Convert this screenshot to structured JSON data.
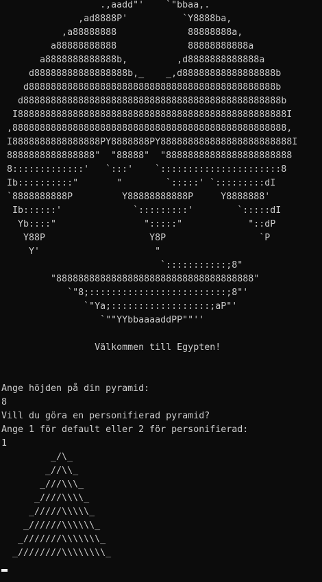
{
  "colors": {
    "background": "#0c0c0c",
    "text": "#cccccc",
    "cursor": "#f2f2f2"
  },
  "console": {
    "ascii_art": [
      "                  .,aadd\"'    `\"bbaa,.",
      "              ,ad8888P'          `Y8888ba,",
      "           ,a88888888             88888888a,",
      "         a88888888888             88888888888a",
      "       a8888888888888b,         ,d8888888888888a",
      "     d88888888888888888b,_    _,d88888888888888888b",
      "    d888888888888888888888888888888888888888888888b",
      "   d88888888888888888888888888888888888888888888888b",
      "  I8888888888888888888888888888888888888888888888888I",
      " ,88888888888888888888888888888888888888888888888888,",
      " I8888888888888888PY8888888PY888888888888888888888888I",
      " 8888888888888888\"  \"88888\"  \"88888888888888888888888",
      " 8:::::::::::::'   `:::'    `::::::::::::::::::::::8",
      " Ib::::::::::\"       \"        `:::::' `:::::::::dI",
      " `8888888888P         Y88888888888P     Y8888888'",
      "  Ib::::::'             `:::::::::'        `:::::dI",
      "   Yb::::\"                \":::::\"            \"::dP",
      "    Y88P                   Y8P                 `P",
      "     Y'                     \"",
      "                             `:::::::::::;8\"",
      "         \"888888888888888888888888888888888888\"",
      "            `\"8;:::::::::::::::::::::::::;8\"'",
      "               `\"Ya;::::::::::::::::::;aP\"'",
      "                  `\"\"YYbbaaaaddPP\"\"''"
    ],
    "welcome": "                 Välkommen till Egypten!",
    "prompt_height": "Ange höjden på din pyramid:",
    "input_height": "8",
    "prompt_custom": "Vill du göra en personifierad pyramid?",
    "prompt_choice": "Ange 1 för default eller 2 för personifierad:",
    "input_choice": "1",
    "pyramid": [
      "         _/\\_",
      "        _//\\\\_",
      "       _///\\\\\\_",
      "      _////\\\\\\\\_",
      "     _/////\\\\\\\\\\_",
      "    _//////\\\\\\\\\\\\_",
      "   _///////\\\\\\\\\\\\\\_",
      "  _////////\\\\\\\\\\\\\\\\_"
    ]
  }
}
